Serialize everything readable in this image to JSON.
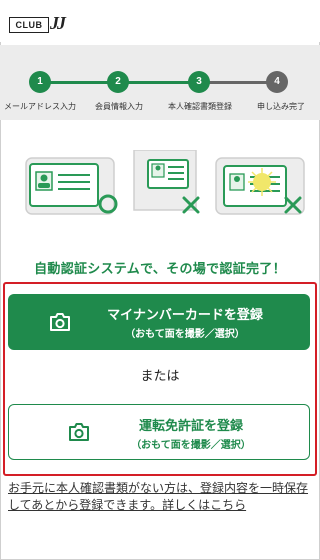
{
  "brand": {
    "club": "CLUB",
    "jj": "JJ"
  },
  "stepper": {
    "steps": [
      {
        "number": "1",
        "label": "メールアドレス入力",
        "state": "done"
      },
      {
        "number": "2",
        "label": "会員情報入力",
        "state": "done"
      },
      {
        "number": "3",
        "label": "本人確認書類登録",
        "state": "current"
      },
      {
        "number": "4",
        "label": "申し込み完了",
        "state": "todo"
      }
    ]
  },
  "headline": "自動認証システムで、その場で認証完了！",
  "mynumber_button": {
    "main": "マイナンバーカードを登録",
    "sub": "（おもて面を撮影／選択）"
  },
  "or_text": "または",
  "license_button": {
    "main": "運転免許証を登録",
    "sub": "（おもて面を撮影／選択）"
  },
  "footer_note": "お手元に本人確認書類がない方は、登録内容を一時保存してあとから登録できます。詳しくはこちら",
  "colors": {
    "accent": "#1f8a4c",
    "highlight_border": "#d41e26",
    "stepper_bg": "#ececec"
  }
}
